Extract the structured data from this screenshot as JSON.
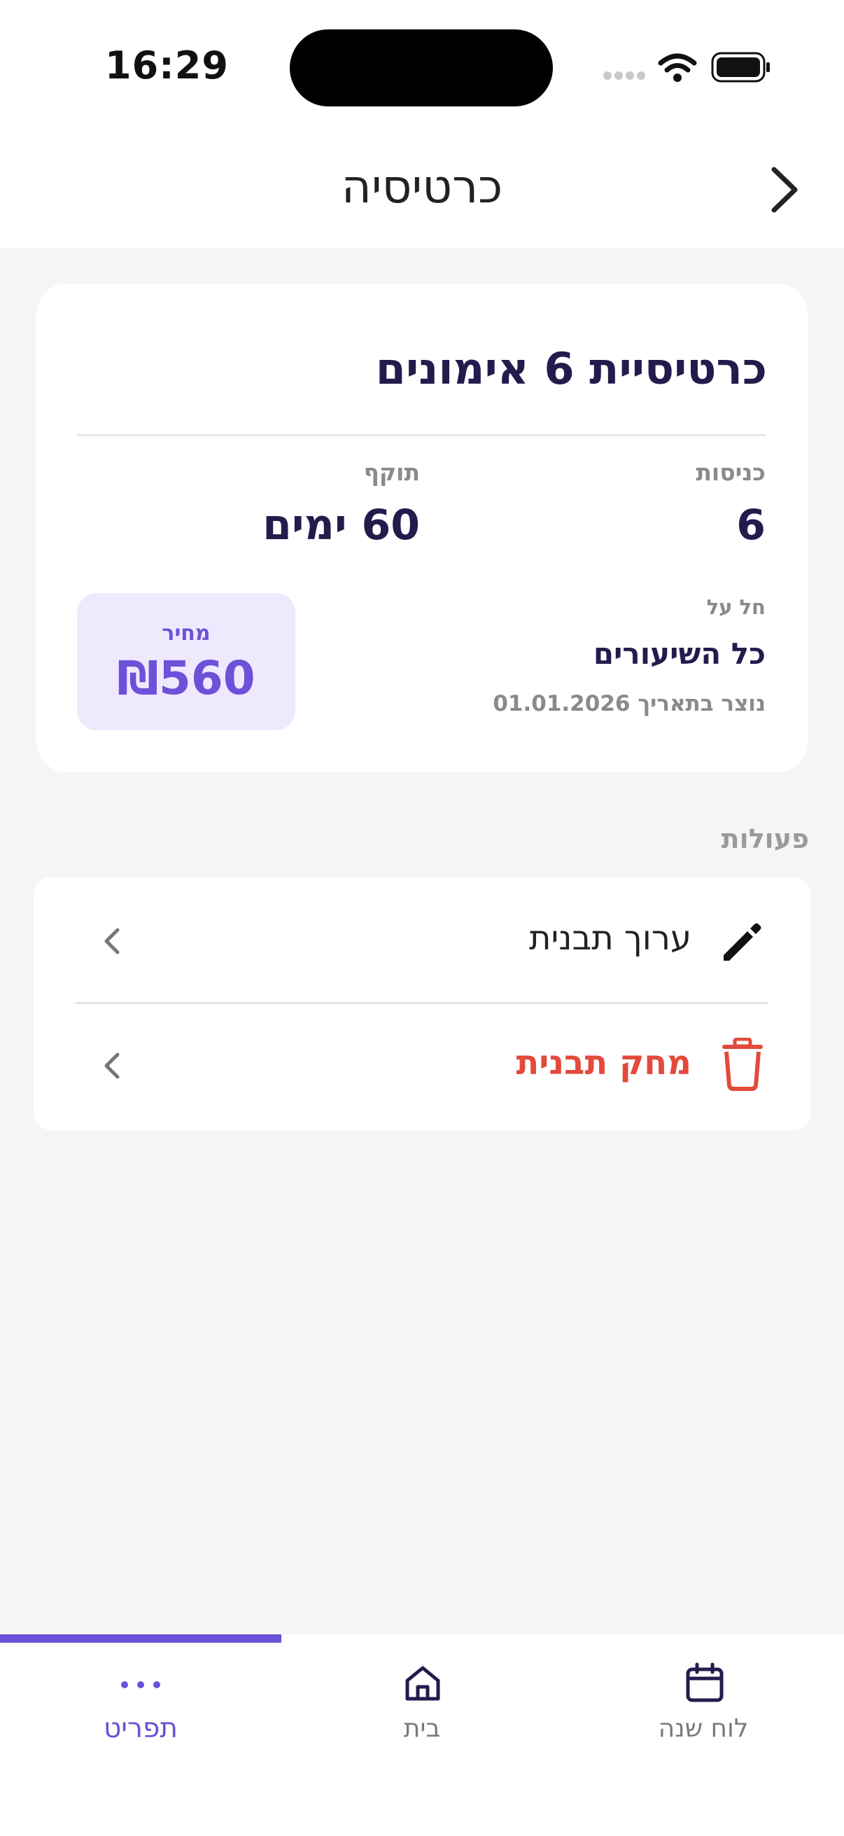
{
  "status_bar": {
    "time": "16:29"
  },
  "header": {
    "title": "כרטיסיה"
  },
  "card": {
    "title": "כרטיסיית 6 אימונים",
    "entries_label": "כניסות",
    "entries_value": "6",
    "validity_label": "תוקף",
    "validity_value": "60 ימים",
    "applies_label": "חל על",
    "applies_value": "כל השיעורים",
    "created_text": "נוצר בתאריך 01.01.2026",
    "price_label": "מחיר",
    "price_value": "₪560"
  },
  "actions": {
    "section_title": "פעולות",
    "items": [
      {
        "label": "ערוך תבנית",
        "icon": "pencil-icon"
      },
      {
        "label": "מחק תבנית",
        "icon": "trash-icon"
      }
    ]
  },
  "tabbar": {
    "active": "more",
    "tabs": [
      {
        "id": "more",
        "label": "תפריט",
        "icon": "more-dots-icon"
      },
      {
        "id": "home",
        "label": "בית",
        "icon": "home-icon"
      },
      {
        "id": "schedule",
        "label": "לוח שנה",
        "icon": "calendar-icon"
      }
    ]
  },
  "colors": {
    "accent": "#6b52d8",
    "accent_bg": "#efe9fe",
    "text_dark": "#241b4d",
    "danger": "#e24a3b",
    "muted": "#8a8a8a"
  }
}
